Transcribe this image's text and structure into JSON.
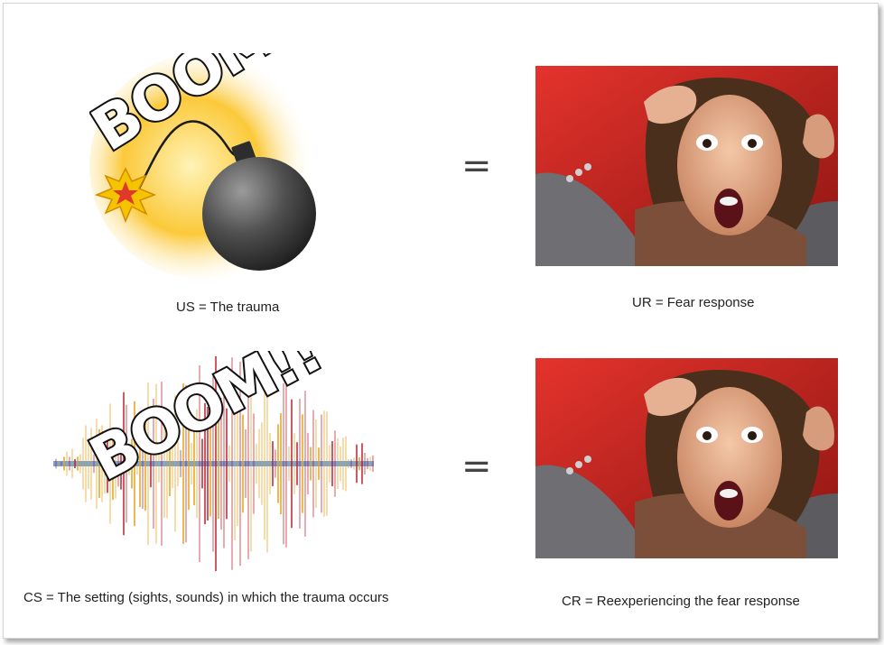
{
  "panels": [
    {
      "stimulus_caption": "US = The trauma",
      "stimulus_art": "bomb-boom-illustration",
      "equals_sign": "=",
      "response_caption": "UR = Fear response",
      "response_art": "frightened-person-photo"
    },
    {
      "stimulus_caption": "CS = The setting (sights, sounds) in which the trauma occurs",
      "stimulus_art": "sound-wave-boom-illustration",
      "equals_sign": "=",
      "response_caption": "CR = Reexperiencing the fear response",
      "response_art": "frightened-person-photo"
    }
  ],
  "boom_word": "BOOM!!",
  "colors": {
    "glow": "#f6b300",
    "bomb": "#4a4a4a",
    "spark": "#f5c400",
    "wave_blue": "#2f7fd8",
    "wave_red": "#c0222e",
    "photo_bg": "#c9201e"
  }
}
